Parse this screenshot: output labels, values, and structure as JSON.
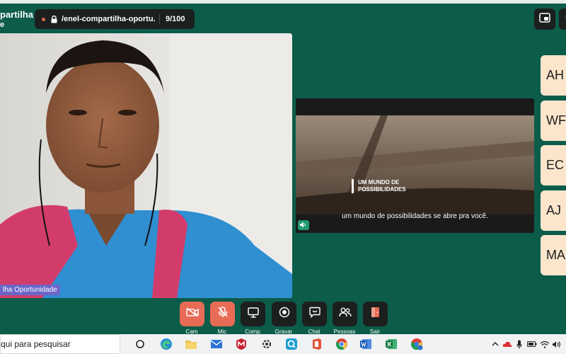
{
  "meeting": {
    "title": "partilha",
    "subtitle": "e",
    "url": "/enel-compartilha-oportu...",
    "participant_count": "9/100"
  },
  "camera": {
    "name_tag": "lha Oportunidade"
  },
  "video": {
    "overlay_text_line1": "UM MUNDO DE",
    "overlay_text_line2": "POSSIBILIDADES",
    "subtitle": "um mundo de possibilidades se abre pra você."
  },
  "participants": [
    "AH",
    "WF",
    "EC",
    "AJ",
    "MA"
  ],
  "controls": [
    {
      "label": "Cam",
      "icon": "camera-off-icon",
      "style": "red"
    },
    {
      "label": "Mic",
      "icon": "mic-off-icon",
      "style": "red"
    },
    {
      "label": "Comp",
      "icon": "screen-share-icon",
      "style": "dark"
    },
    {
      "label": "Gravar",
      "icon": "record-icon",
      "style": "dark"
    },
    {
      "label": "Chat",
      "icon": "chat-icon",
      "style": "dark"
    },
    {
      "label": "Pessoas",
      "icon": "people-icon",
      "style": "dark"
    },
    {
      "label": "Sair",
      "icon": "exit-icon",
      "style": "dark"
    }
  ],
  "taskbar": {
    "search_placeholder": "qui para pesquisar"
  },
  "colors": {
    "background": "#0c5c4a",
    "control_red": "#e86b56",
    "control_dark": "#1b1f1e",
    "participant_tile": "#fbe6cc",
    "name_tag": "#6b65c9"
  }
}
